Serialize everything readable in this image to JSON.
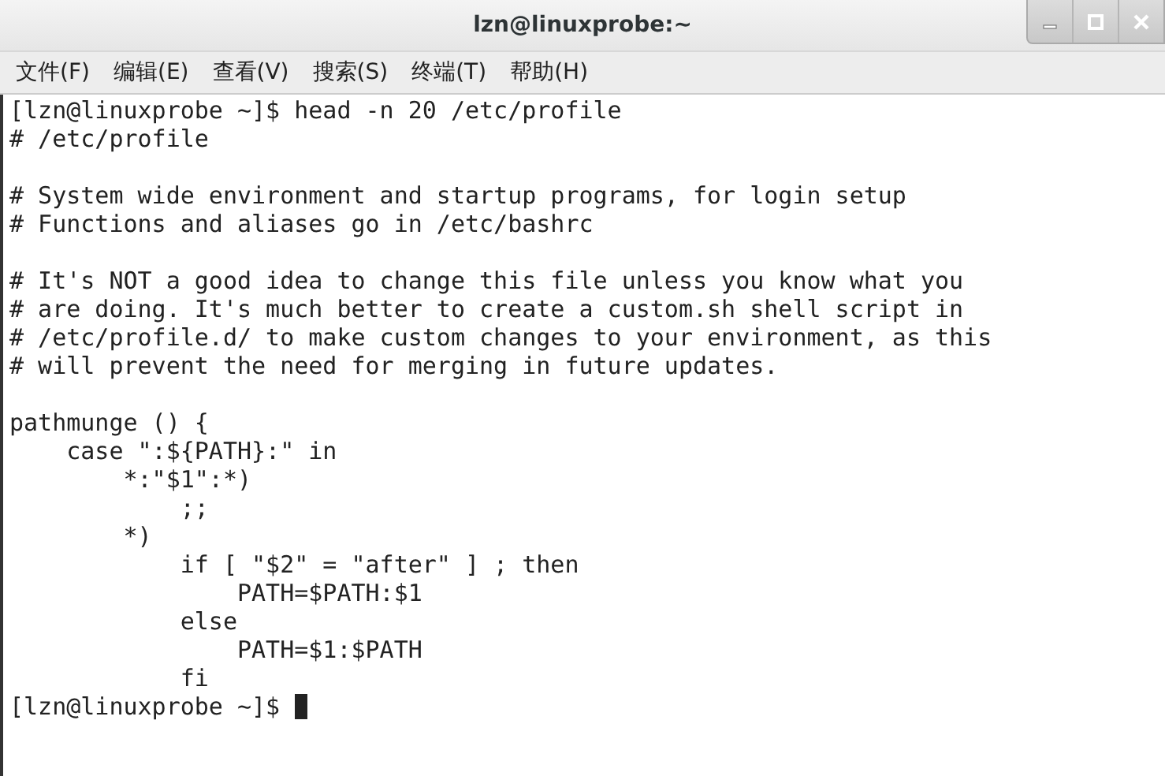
{
  "window": {
    "title": "lzn@linuxprobe:~"
  },
  "menu": [
    "文件(F)",
    "编辑(E)",
    "查看(V)",
    "搜索(S)",
    "终端(T)",
    "帮助(H)"
  ],
  "terminal": {
    "blocks": [
      [
        "[lzn@linuxprobe ~]$ head -n 20 /etc/profile",
        "# /etc/profile"
      ],
      [
        "# System wide environment and startup programs, for login setup",
        "# Functions and aliases go in /etc/bashrc"
      ],
      [
        "# It's NOT a good idea to change this file unless you know what you",
        "# are doing. It's much better to create a custom.sh shell script in",
        "# /etc/profile.d/ to make custom changes to your environment, as this",
        "# will prevent the need for merging in future updates."
      ],
      [
        "pathmunge () {",
        "    case \":${PATH}:\" in",
        "        *:\"$1\":*)",
        "            ;;",
        "        *)",
        "            if [ \"$2\" = \"after\" ] ; then",
        "                PATH=$PATH:$1",
        "            else",
        "                PATH=$1:$PATH",
        "            fi"
      ]
    ],
    "prompt": {
      "text": "[lzn@linuxprobe ~]$",
      "cursor": true
    }
  }
}
